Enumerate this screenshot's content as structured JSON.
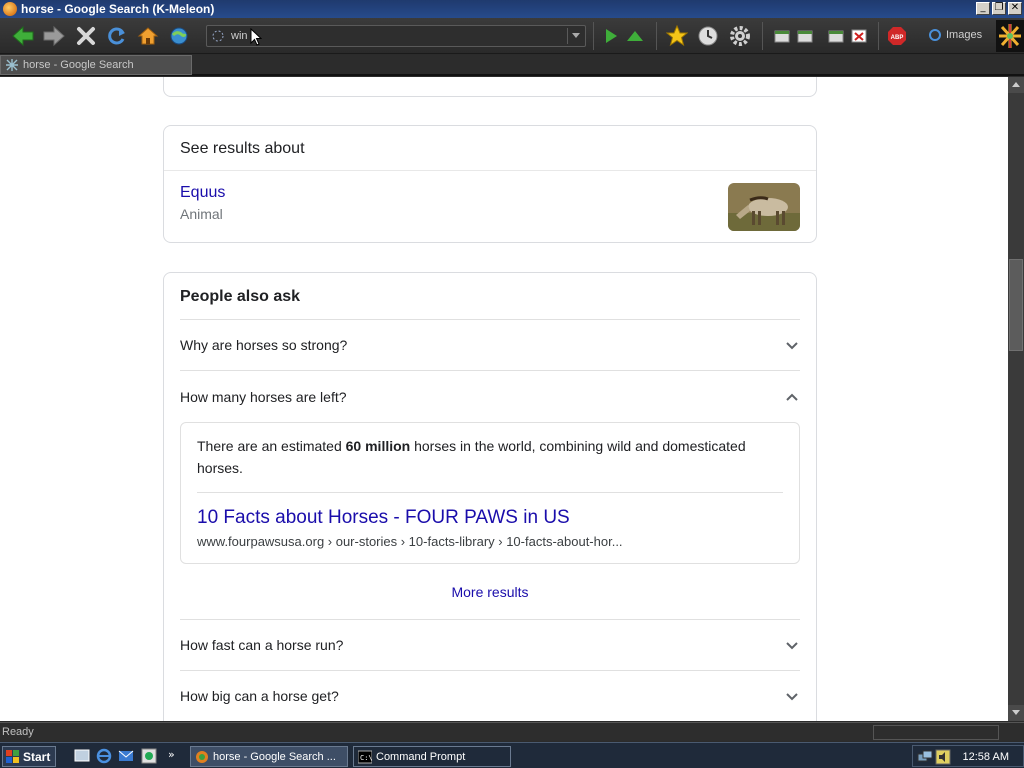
{
  "window": {
    "title": "horse - Google Search (K-Meleon)"
  },
  "toolbar": {
    "url_value": "win",
    "images_label": "Images"
  },
  "tabs": [
    {
      "label": "horse - Google Search"
    }
  ],
  "about": {
    "heading": "See results about",
    "item_title": "Equus",
    "item_subtitle": "Animal"
  },
  "paa": {
    "heading": "People also ask",
    "questions": [
      {
        "text": "Why are horses so strong?",
        "expanded": false
      },
      {
        "text": "How many horses are left?",
        "expanded": true
      },
      {
        "text": "How fast can a horse run?",
        "expanded": false
      },
      {
        "text": "How big can a horse get?",
        "expanded": false
      }
    ],
    "answer": {
      "text_before": "There are an estimated ",
      "text_bold": "60 million",
      "text_after": " horses in the world, combining wild and domesticated horses.",
      "link_title": "10 Facts about Horses - FOUR PAWS in US",
      "link_url": "www.fourpawsusa.org › our-stories › 10-facts-library › 10-facts-about-hor..."
    },
    "more_results": "More results"
  },
  "status": {
    "text": "Ready"
  },
  "taskbar": {
    "start_label": "Start",
    "tasks": [
      {
        "label": "horse - Google Search ...",
        "active": true
      },
      {
        "label": "Command Prompt",
        "active": false
      }
    ],
    "clock": "12:58 AM"
  },
  "colors": {
    "link": "#1a0dab",
    "text": "#202124",
    "titlebar": "#274b8c"
  }
}
